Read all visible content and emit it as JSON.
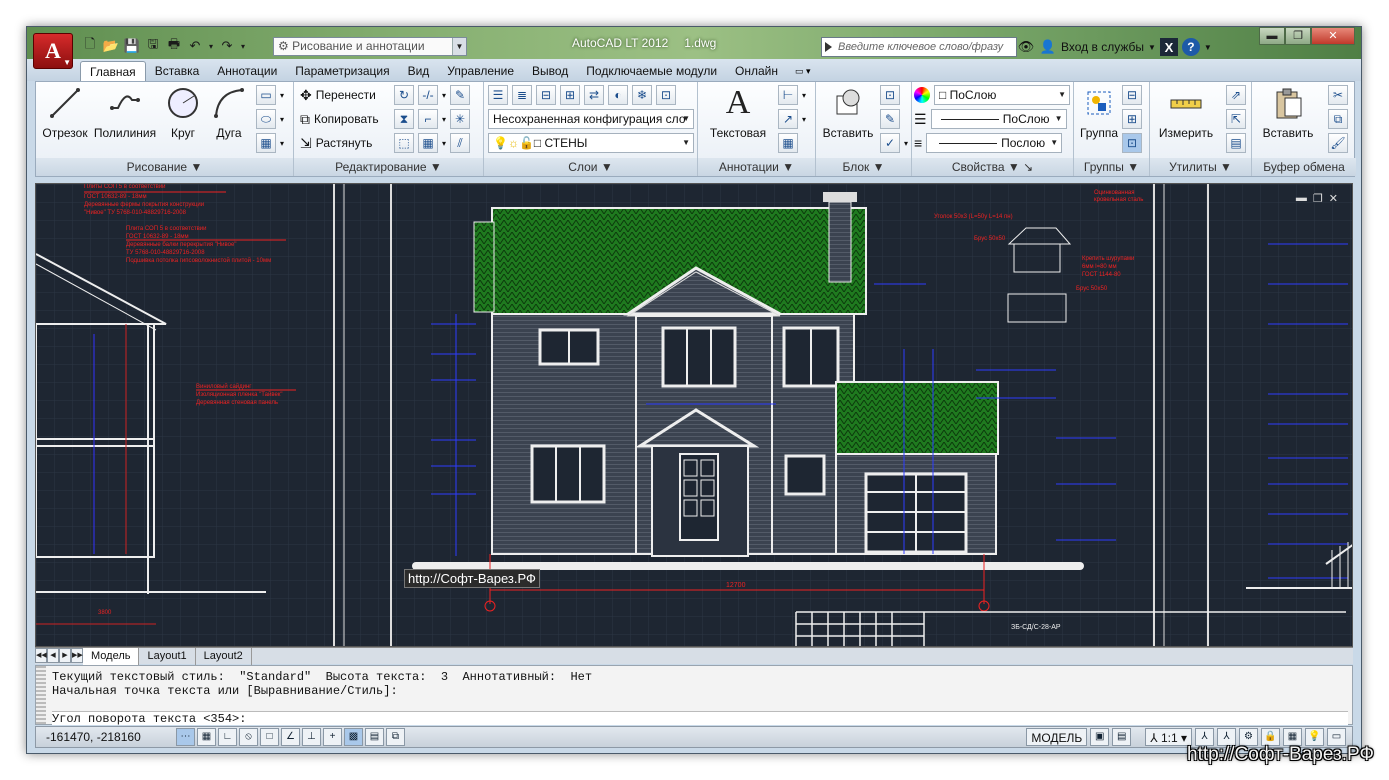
{
  "titlebar": {
    "app_name": "AutoCAD LT 2012",
    "file_name": "1.dwg",
    "workspace": "Рисование и аннотации",
    "search_placeholder": "Введите ключевое слово/фразу",
    "signin": "Вход в службы",
    "logo_letter": "A"
  },
  "tabs": [
    "Главная",
    "Вставка",
    "Аннотации",
    "Параметризация",
    "Вид",
    "Управление",
    "Вывод",
    "Подключаемые модули",
    "Онлайн"
  ],
  "ribbon": {
    "draw": {
      "title": "Рисование",
      "line": "Отрезок",
      "polyline": "Полилиния",
      "circle": "Круг",
      "arc": "Дуга"
    },
    "modify": {
      "title": "Редактирование",
      "move": "Перенести",
      "copy": "Копировать",
      "stretch": "Растянуть"
    },
    "layers": {
      "title": "Слои",
      "state": "Несохраненная конфигурация сло",
      "current": "СТЕНЫ"
    },
    "annotation": {
      "title": "Аннотации",
      "text": "Текстовая"
    },
    "block": {
      "title": "Блок",
      "insert": "Вставить"
    },
    "properties": {
      "title": "Свойства",
      "color": "ПоСлою",
      "linetype": "ПоСлою",
      "lineweight": "Послою"
    },
    "groups": {
      "title": "Группы",
      "group": "Группа"
    },
    "utilities": {
      "title": "Утилиты",
      "measure": "Измерить"
    },
    "clipboard": {
      "title": "Буфер обмена",
      "paste": "Вставить"
    }
  },
  "drawing": {
    "url_label": "http://Софт-Варез.РФ",
    "stamp": "ЗБ-СД/С-28-АР",
    "dim_total": "12700",
    "dim_left": "3800"
  },
  "layout_tabs": [
    "Модель",
    "Layout1",
    "Layout2"
  ],
  "command": {
    "line1": "Текущий текстовый стиль:  \"Standard\"  Высота текста:  3  Аннотативный:  Нет",
    "line2": "Начальная точка текста или [Выравнивание/Стиль]:",
    "prompt": "Угол поворота текста <354>:"
  },
  "status": {
    "coords": "-161470, -218160",
    "model": "МОДЕЛЬ",
    "scale": "1:1"
  },
  "watermark": "http://Софт-Варез.РФ"
}
